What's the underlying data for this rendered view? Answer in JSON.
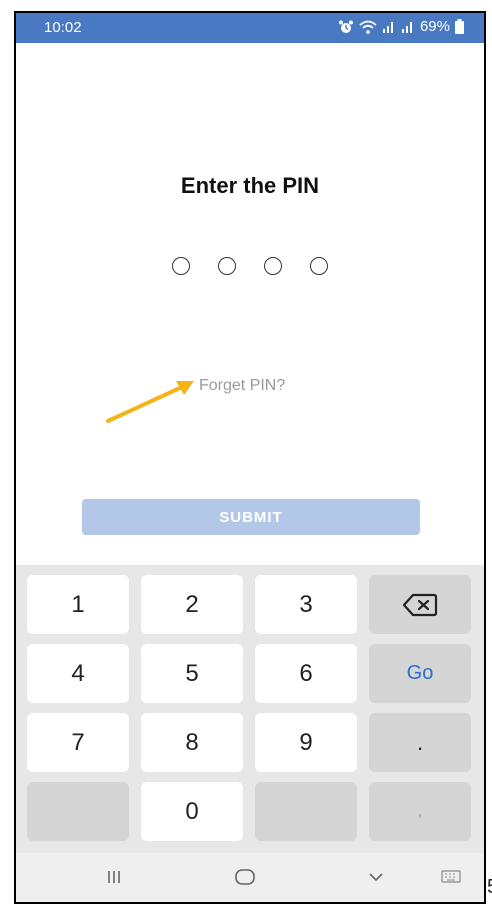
{
  "status_bar": {
    "time": "10:02",
    "battery": "69%",
    "icons": [
      "alarm-icon",
      "wifi-icon",
      "signal-icon",
      "signal-icon",
      "battery-icon"
    ],
    "background": "#4a79c4"
  },
  "main": {
    "title": "Enter the PIN",
    "pin_length": 4,
    "forget_link": "Forget PIN?",
    "submit_label": "SUBMIT",
    "accent_color": "#f5b316"
  },
  "keyboard": {
    "keys": [
      {
        "label": "1",
        "type": "digit"
      },
      {
        "label": "2",
        "type": "digit"
      },
      {
        "label": "3",
        "type": "digit"
      },
      {
        "label": "",
        "type": "backspace",
        "icon": "backspace-icon"
      },
      {
        "label": "4",
        "type": "digit"
      },
      {
        "label": "5",
        "type": "digit"
      },
      {
        "label": "6",
        "type": "digit"
      },
      {
        "label": "Go",
        "type": "go"
      },
      {
        "label": "7",
        "type": "digit"
      },
      {
        "label": "8",
        "type": "digit"
      },
      {
        "label": "9",
        "type": "digit"
      },
      {
        "label": ".",
        "type": "punct"
      },
      {
        "label": "",
        "type": "blank"
      },
      {
        "label": "0",
        "type": "digit"
      },
      {
        "label": "",
        "type": "blank"
      },
      {
        "label": ",",
        "type": "comma"
      }
    ]
  },
  "nav_bar": {
    "icons": [
      "recent-apps-icon",
      "home-icon",
      "back-icon",
      "keyboard-toggle-icon"
    ]
  },
  "edge_text": "5"
}
